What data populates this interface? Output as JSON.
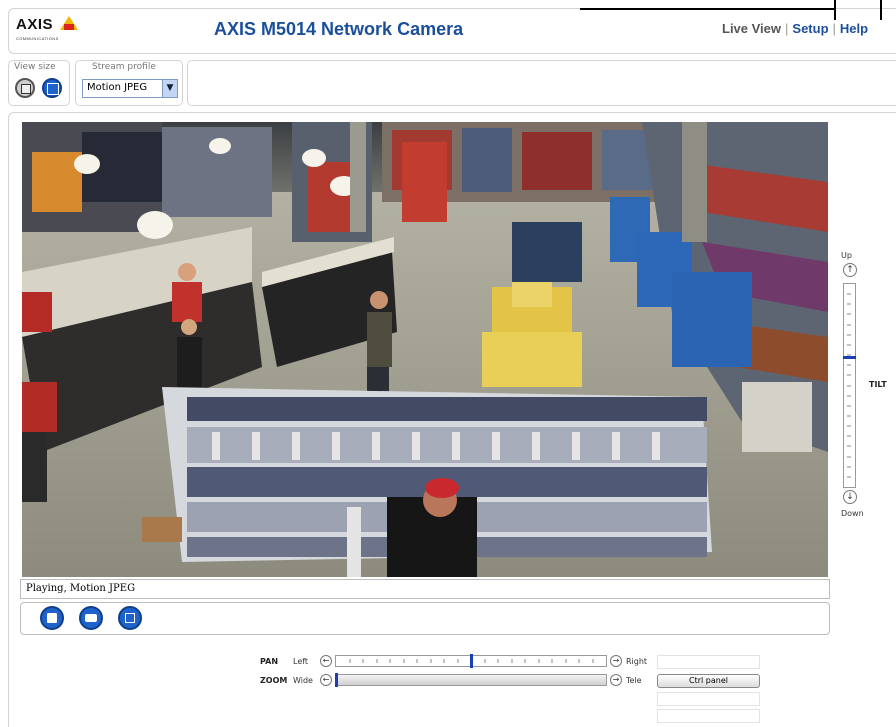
{
  "header": {
    "logo_text": "AXIS",
    "logo_subtext": "COMMUNICATIONS",
    "title": "AXIS M5014 Network Camera",
    "nav": {
      "live_view": "Live View",
      "setup": "Setup",
      "help": "Help",
      "separator": "|"
    }
  },
  "toolbar": {
    "view_size_label": "View size",
    "stream_profile_label": "Stream profile",
    "stream_profile_value": "Motion JPEG"
  },
  "video": {
    "status": "Playing, Motion JPEG"
  },
  "tilt": {
    "label": "TILT",
    "up": "Up",
    "down": "Down",
    "position": 0.36
  },
  "pan": {
    "label": "PAN",
    "left": "Left",
    "right": "Right",
    "position": 0.5
  },
  "zoom": {
    "label": "ZOOM",
    "wide": "Wide",
    "tele": "Tele",
    "position": 0.0
  },
  "ctrl_panel_label": "Ctrl panel",
  "colors": {
    "brand_blue": "#1b4f9c",
    "button_blue": "#1f62c9",
    "logo_yellow": "#f2b705",
    "logo_red": "#d9261c"
  },
  "icons": [
    "view-size-small-icon",
    "view-size-large-icon",
    "dropdown-arrow-icon",
    "stop-icon",
    "snapshot-icon",
    "fullscreen-icon",
    "arrow-up-icon",
    "arrow-down-icon",
    "arrow-left-icon",
    "arrow-right-icon"
  ]
}
